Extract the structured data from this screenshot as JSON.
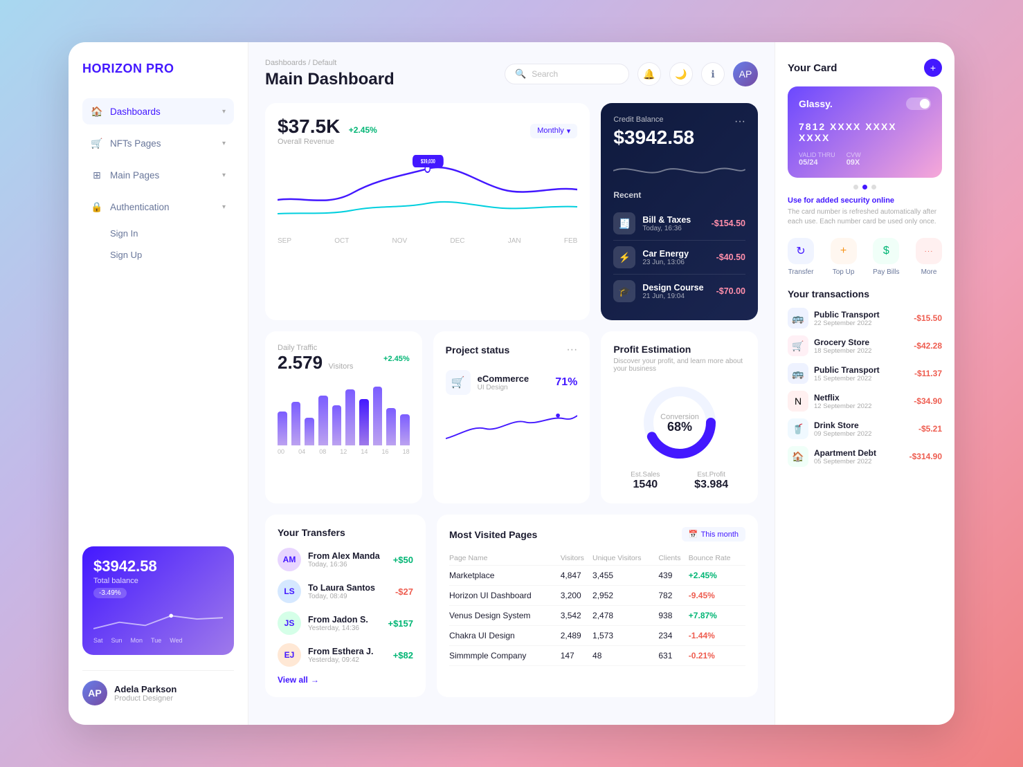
{
  "app": {
    "name": "HORIZON",
    "nameSuffix": " PRO"
  },
  "breadcrumb": "Dashboards / Default",
  "pageTitle": "Main Dashboard",
  "search": {
    "placeholder": "Search"
  },
  "sidebar": {
    "navItems": [
      {
        "id": "dashboards",
        "label": "Dashboards",
        "icon": "🏠",
        "active": true
      },
      {
        "id": "nfts",
        "label": "NFTs Pages",
        "icon": "🛒",
        "active": false
      },
      {
        "id": "main-pages",
        "label": "Main Pages",
        "icon": "⊞",
        "active": false
      },
      {
        "id": "authentication",
        "label": "Authentication",
        "icon": "🔒",
        "active": false
      }
    ],
    "authSubItems": [
      "Sign In",
      "Sign Up"
    ],
    "miniCard": {
      "amount": "$3942.58",
      "label": "Total balance",
      "badge": "-3.49%",
      "days": [
        "Sat",
        "Sun",
        "Mon",
        "Tue",
        "Wed"
      ]
    },
    "user": {
      "name": "Adela Parkson",
      "role": "Product Designer",
      "initials": "AP"
    }
  },
  "revenue": {
    "amount": "$37.5K",
    "badge": "+2.45%",
    "label": "Overall Revenue",
    "period": "Monthly",
    "chartLabels": [
      "SEP",
      "OCT",
      "NOV",
      "DEC",
      "JAN",
      "FEB"
    ]
  },
  "creditBalance": {
    "label": "Credit Balance",
    "amount": "$3942.58",
    "recent": "Recent",
    "transactions": [
      {
        "name": "Bill & Taxes",
        "date": "Today, 16:36",
        "amount": "-$154.50",
        "icon": "🧾",
        "color": "#f0f4ff"
      },
      {
        "name": "Car Energy",
        "date": "23 Jun, 13:06",
        "amount": "-$40.50",
        "icon": "⚡",
        "color": "#e8fff4"
      },
      {
        "name": "Design Course",
        "date": "21 Jun, 19:04",
        "amount": "-$70.00",
        "icon": "🎓",
        "color": "#fff8e8"
      }
    ]
  },
  "dailyTraffic": {
    "label": "Daily Traffic",
    "amount": "2.579",
    "unit": "Visitors",
    "badge": "+2.45%",
    "bars": [
      55,
      70,
      45,
      80,
      65,
      90,
      75,
      95,
      60,
      50
    ],
    "barLabels": [
      "00",
      "04",
      "08",
      "12",
      "14",
      "16",
      "18"
    ]
  },
  "projectStatus": {
    "title": "Project status",
    "items": [
      {
        "name": "eCommerce",
        "sub": "UI Design",
        "pct": "71%"
      }
    ]
  },
  "profitEstimation": {
    "title": "Profit Estimation",
    "sub": "Discover your profit, and learn more about your business",
    "conversion": "68%",
    "conversionLabel": "Conversion",
    "estSalesLabel": "Est.Sales",
    "estSalesValue": "1540",
    "estProfitLabel": "Est.Profit",
    "estProfitValue": "$3.984"
  },
  "yourTransfers": {
    "title": "Your Transfers",
    "items": [
      {
        "name": "From Alex Manda",
        "date": "Today, 16:36",
        "amount": "+$50",
        "positive": true,
        "initials": "AM"
      },
      {
        "name": "To Laura Santos",
        "date": "Today, 08:49",
        "amount": "-$27",
        "positive": false,
        "initials": "LS"
      },
      {
        "name": "From Jadon S.",
        "date": "Yesterday, 14:36",
        "amount": "+$157",
        "positive": true,
        "initials": "JS"
      },
      {
        "name": "From Esthera J.",
        "date": "Yesterday, 09:42",
        "amount": "+$82",
        "positive": true,
        "initials": "EJ"
      }
    ],
    "viewAll": "View all"
  },
  "mostVisited": {
    "title": "Most Visited Pages",
    "periodBtn": "This month",
    "headers": [
      "Page Name",
      "Visitors",
      "Unique Visitors",
      "Clients",
      "Bounce Rate"
    ],
    "rows": [
      {
        "name": "Marketplace",
        "visitors": "4,847",
        "unique": "3,455",
        "clients": "439",
        "bounce": "+2.45%"
      },
      {
        "name": "Horizon UI Dashboard",
        "visitors": "3,200",
        "unique": "2,952",
        "clients": "782",
        "bounce": "-9.45%"
      },
      {
        "name": "Venus Design System",
        "visitors": "3,542",
        "unique": "2,478",
        "clients": "938",
        "bounce": "+7.87%"
      },
      {
        "name": "Chakra UI Design",
        "visitors": "2,489",
        "unique": "1,573",
        "clients": "234",
        "bounce": "-1.44%"
      },
      {
        "name": "Simmmple Company",
        "visitors": "147",
        "unique": "48",
        "clients": "631",
        "bounce": "-0.21%"
      }
    ]
  },
  "yourCard": {
    "title": "Your Card",
    "brand": "Glassy.",
    "number": "7812 XXXX XXXX XXXX",
    "validThruLabel": "VALID THRU",
    "validThruValue": "05/24",
    "cvvLabel": "CVW",
    "cvvValue": "09X",
    "securityNote": "Use for added security online",
    "securitySub": "The card number is refreshed automatically after each use. Each number card be used only once."
  },
  "quickActions": [
    {
      "id": "transfer",
      "label": "Transfer",
      "icon": "↻",
      "colorClass": "qa-blue"
    },
    {
      "id": "top-up",
      "label": "Top Up",
      "icon": "+",
      "colorClass": "qa-orange"
    },
    {
      "id": "pay-bills",
      "label": "Pay Bills",
      "icon": "$",
      "colorClass": "qa-green"
    },
    {
      "id": "more",
      "label": "More",
      "icon": "···",
      "colorClass": "qa-red"
    }
  ],
  "yourTransactions": {
    "title": "Your transactions",
    "items": [
      {
        "name": "Public Transport",
        "date": "22 September 2022",
        "amount": "-$15.50",
        "icon": "🚌",
        "bg": "#eef2ff"
      },
      {
        "name": "Grocery Store",
        "date": "18 September 2022",
        "amount": "-$42.28",
        "icon": "🛒",
        "bg": "#fff0f5"
      },
      {
        "name": "Public Transport",
        "date": "15 September 2022",
        "amount": "-$11.37",
        "icon": "🚌",
        "bg": "#eef2ff"
      },
      {
        "name": "Netflix",
        "date": "12 September 2022",
        "amount": "-$34.90",
        "icon": "N",
        "bg": "#fff0f0"
      },
      {
        "name": "Drink Store",
        "date": "09 September 2022",
        "amount": "-$5.21",
        "icon": "🥤",
        "bg": "#f0f9ff"
      },
      {
        "name": "Apartment Debt",
        "date": "05 September 2022",
        "amount": "-$314.90",
        "icon": "🏠",
        "bg": "#f0fff8"
      }
    ]
  }
}
